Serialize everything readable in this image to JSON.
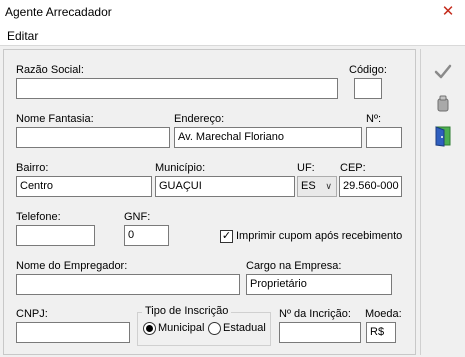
{
  "window": {
    "title": "Agente Arrecadador",
    "close_glyph": "✕"
  },
  "menu": {
    "items": [
      {
        "label": "Editar"
      }
    ]
  },
  "fields": {
    "razao_social": {
      "label": "Razão Social:",
      "value": ""
    },
    "codigo": {
      "label": "Código:",
      "value": ""
    },
    "nome_fantasia": {
      "label": "Nome Fantasia:",
      "value": ""
    },
    "endereco": {
      "label": "Endereço:",
      "value": "Av. Marechal Floriano"
    },
    "numero": {
      "label": "Nº:",
      "value": ""
    },
    "bairro": {
      "label": "Bairro:",
      "value": "Centro"
    },
    "municipio": {
      "label": "Município:",
      "value": "GUAÇUI"
    },
    "uf": {
      "label": "UF:",
      "value": "ES"
    },
    "cep": {
      "label": "CEP:",
      "value": "29.560-000"
    },
    "telefone": {
      "label": "Telefone:",
      "value": ""
    },
    "gnf": {
      "label": "GNF:",
      "value": "0"
    },
    "imprimir_cupom": {
      "label": "Imprimir cupom após recebimento",
      "checked": true
    },
    "nome_empregador": {
      "label": "Nome do Empregador:",
      "value": ""
    },
    "cargo_empresa": {
      "label": "Cargo na Empresa:",
      "value": "Proprietário"
    },
    "cnpj": {
      "label": "CNPJ:",
      "value": ""
    },
    "tipo_inscricao": {
      "label": "Tipo de Inscrição",
      "options": [
        "Municipal",
        "Estadual"
      ],
      "selected": "Municipal"
    },
    "numero_inscricao": {
      "label": "Nº da Incrição:",
      "value": ""
    },
    "moeda": {
      "label": "Moeda:",
      "value": "R$"
    }
  },
  "toolbar": {
    "items": [
      {
        "icon": "checkmark-icon",
        "action": "confirm"
      },
      {
        "icon": "eraser-icon",
        "action": "clear"
      },
      {
        "icon": "exit-door-icon",
        "action": "exit"
      }
    ]
  },
  "colors": {
    "close": "#c42b1c",
    "panel_bg": "#f0f0f0",
    "exit_icon_blue": "#2f5fbf",
    "exit_icon_green": "#4caf50"
  }
}
